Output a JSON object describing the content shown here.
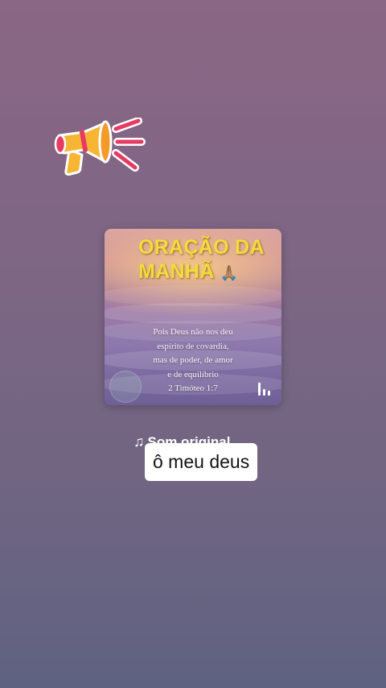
{
  "sticker": {
    "icon": "megaphone-icon"
  },
  "post": {
    "title_line1": "ORAÇÃO DA",
    "title_line2": "MANHÃ",
    "title_emoji": "🙏🏽",
    "verse_lines": [
      "Pois Deus não nos deu",
      "espírito de covardia,",
      "mas de poder, de amor",
      "e de equilíbrio",
      "2 Timóteo 1:7"
    ],
    "icons": [
      "play-circle-icon",
      "audio-bars-icon"
    ]
  },
  "audio": {
    "icon": "music-note-icon",
    "label": "Som original"
  },
  "caption": {
    "text": "ô meu deus"
  },
  "colors": {
    "title": "#f3dc3c",
    "megaphone_body": "#f7b534",
    "megaphone_rays": "#e63b63"
  }
}
